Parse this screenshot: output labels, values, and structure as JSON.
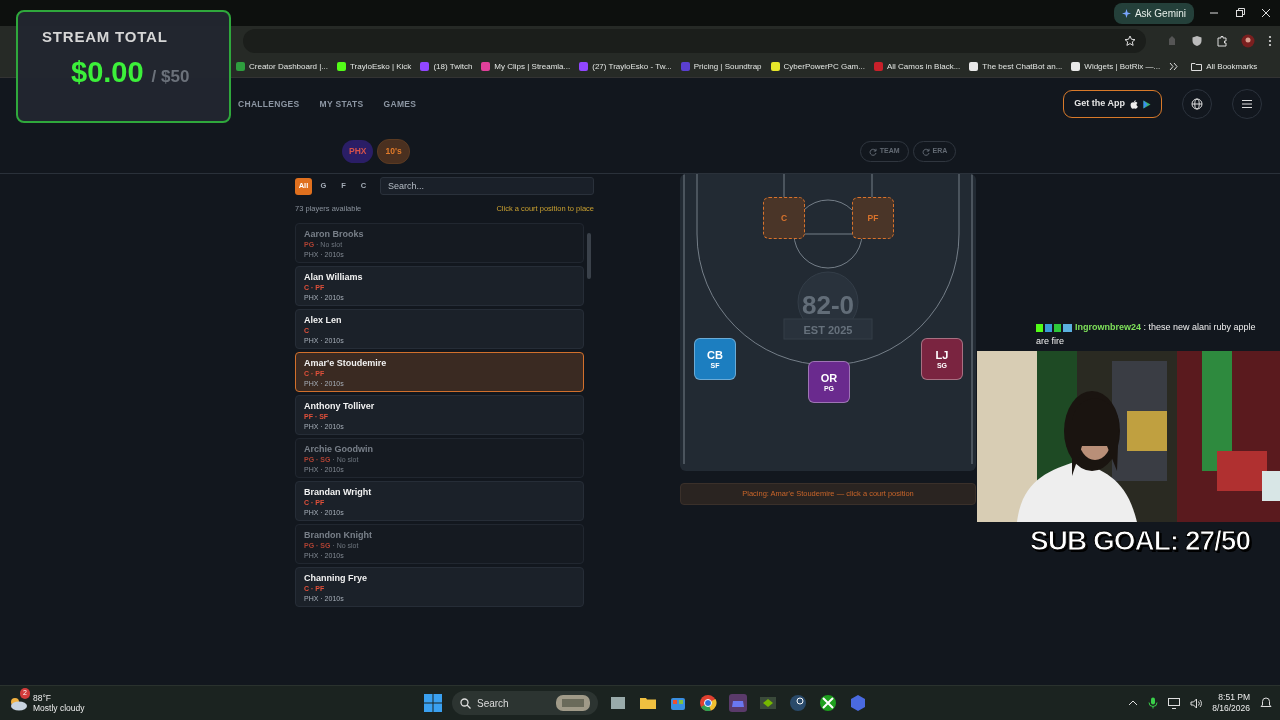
{
  "browser": {
    "ask_gemini": "Ask Gemini"
  },
  "bookmarks": [
    {
      "label": "Creator Dashboard |...",
      "color": "#2e9e3e"
    },
    {
      "label": "TrayloEsko | Kick",
      "color": "#53fc18"
    },
    {
      "label": "(18) Twitch",
      "color": "#9146ff"
    },
    {
      "label": "My Clips | Streamla...",
      "color": "#e0409a"
    },
    {
      "label": "(27) TrayloEsko - Tw...",
      "color": "#9146ff"
    },
    {
      "label": "Pricing | Soundtrap",
      "color": "#5a3fd0"
    },
    {
      "label": "CyberPowerPC Gam...",
      "color": "#e6e62a"
    },
    {
      "label": "All Camos in Black...",
      "color": "#c8202a"
    },
    {
      "label": "The best ChatBot an...",
      "color": "#e8e8e8"
    },
    {
      "label": "Widgets | BotRix —...",
      "color": "#e8e8e8"
    }
  ],
  "all_bookmarks": "All Bookmarks",
  "site_nav": {
    "items": [
      {
        "label": "CHALLENGES",
        "selected": false
      },
      {
        "label": "MY STATS",
        "selected": false
      },
      {
        "label": "GAMES",
        "selected": false
      }
    ],
    "app_button": "Get the App"
  },
  "filters": {
    "chips": [
      {
        "label": "PHX",
        "kind": "team"
      },
      {
        "label": "10's",
        "kind": "era"
      }
    ],
    "rerolls": [
      {
        "label": "TEAM",
        "disabled": true
      },
      {
        "label": "ERA",
        "disabled": true
      }
    ]
  },
  "positions": [
    {
      "label": "All",
      "selected": true
    },
    {
      "label": "G",
      "selected": false
    },
    {
      "label": "F",
      "selected": false
    },
    {
      "label": "C",
      "selected": false
    }
  ],
  "search": {
    "placeholder": "Search..."
  },
  "count": "73 players available",
  "hint": "Click a court position to place",
  "players": [
    {
      "name": "Aaron Brooks",
      "positions": "PG",
      "note": "· No slot",
      "team_era": "PHX · 2010s",
      "disabled": true,
      "selected": false
    },
    {
      "name": "Alan Williams",
      "positions": "C · PF",
      "team_era": "PHX · 2010s",
      "disabled": false,
      "selected": false
    },
    {
      "name": "Alex Len",
      "positions": "C",
      "team_era": "PHX · 2010s",
      "disabled": false,
      "selected": false
    },
    {
      "name": "Amar'e Stoudemire",
      "positions": "C · PF",
      "team_era": "PHX · 2010s",
      "disabled": false,
      "selected": true
    },
    {
      "name": "Anthony Tolliver",
      "positions": "PF · SF",
      "team_era": "PHX · 2010s",
      "disabled": false,
      "selected": false
    },
    {
      "name": "Archie Goodwin",
      "positions": "PG · SG",
      "note": "· No slot",
      "team_era": "PHX · 2010s",
      "disabled": true,
      "selected": false
    },
    {
      "name": "Brandan Wright",
      "positions": "C · PF",
      "team_era": "PHX · 2010s",
      "disabled": false,
      "selected": false
    },
    {
      "name": "Brandon Knight",
      "positions": "PG · SG",
      "note": "· No slot",
      "team_era": "PHX · 2010s",
      "disabled": true,
      "selected": false
    },
    {
      "name": "Channing Frye",
      "positions": "C · PF",
      "team_era": "PHX · 2010s",
      "disabled": false,
      "selected": false
    }
  ],
  "court": {
    "logo_title": "82-0",
    "logo_subtitle": "EST 2025",
    "slots": [
      {
        "kind": "empty",
        "label": "C"
      },
      {
        "kind": "empty",
        "label": "PF"
      },
      {
        "kind": "filled",
        "initials": "CB",
        "position": "SF",
        "color": "#1c7ec0"
      },
      {
        "kind": "filled",
        "initials": "OR",
        "position": "PG",
        "color": "#6a2a8e"
      },
      {
        "kind": "filled",
        "initials": "LJ",
        "position": "SG",
        "color": "#7a2440"
      }
    ]
  },
  "status": "Placing: Amar'e Stoudemire — click a court position",
  "stream_total": {
    "title": "STREAM TOTAL",
    "amount": "$0.00",
    "goal": "/ $50"
  },
  "chat": {
    "user": "Ingrownbrew24",
    "message": ": these new alani ruby apple are fire"
  },
  "sub_goal": "SUB GOAL: 27/50",
  "taskbar": {
    "weather_badge": "2",
    "temperature": "88°F",
    "weather": "Mostly cloudy",
    "search": "Search",
    "time": "8:51 PM",
    "date": "8/16/2026"
  }
}
